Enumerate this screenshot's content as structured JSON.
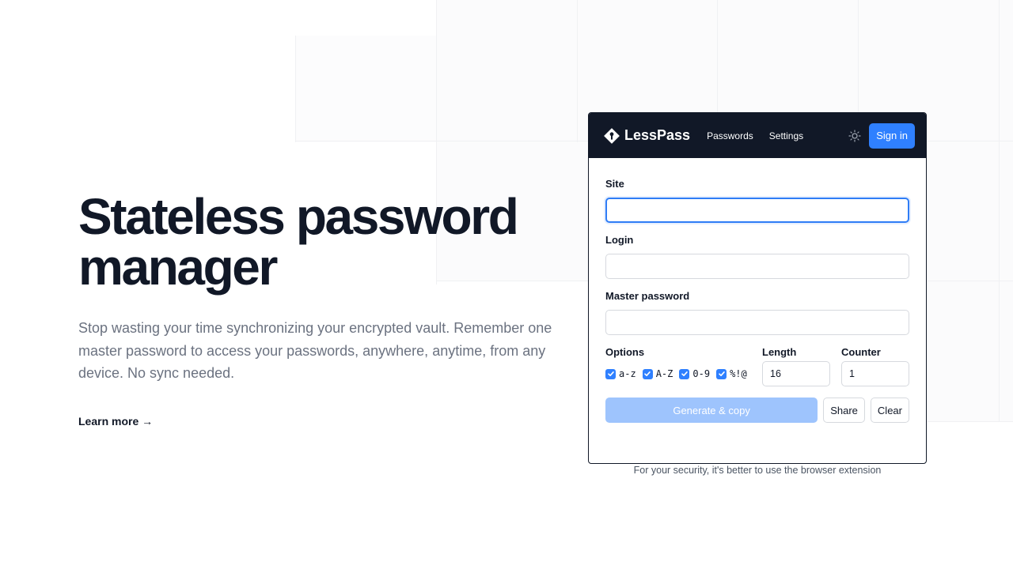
{
  "hero": {
    "title_line1": "Stateless password",
    "title_line2": "manager",
    "lead": "Stop wasting your time synchronizing your encrypted vault. Remember one master password to access your passwords, anywhere, anytime, from any device. No sync needed.",
    "learn_more": "Learn more →"
  },
  "app": {
    "brand": "LessPass",
    "nav": {
      "passwords": "Passwords",
      "settings": "Settings"
    },
    "theme_icon": "sun-icon",
    "signin_label": "Sign in",
    "form": {
      "site_label": "Site",
      "site_value": "",
      "login_label": "Login",
      "login_value": "",
      "master_label": "Master password",
      "master_value": "",
      "options_label": "Options",
      "length_label": "Length",
      "counter_label": "Counter",
      "options": [
        {
          "label": "a-z",
          "checked": true
        },
        {
          "label": "A-Z",
          "checked": true
        },
        {
          "label": "0-9",
          "checked": true
        },
        {
          "label": "%!@",
          "checked": true
        }
      ],
      "length_value": "16",
      "counter_value": "1",
      "generate_label": "Generate & copy",
      "share_label": "Share",
      "clear_label": "Clear"
    },
    "footnote": "For your security, it's better to use the browser extension"
  },
  "colors": {
    "navbar": "#111827",
    "accent": "#2f80ff",
    "accent_disabled": "#9ec4fd",
    "lead_text": "#6b7280"
  }
}
